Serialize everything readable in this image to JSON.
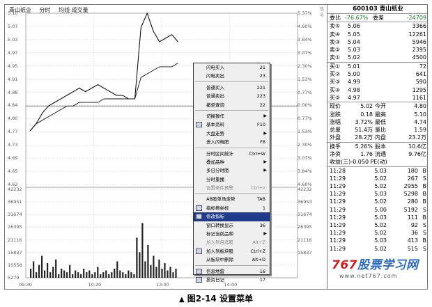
{
  "chart": {
    "title_stock": "青山纸业",
    "title_mode": "分时",
    "title_legend": "均线 成交量",
    "price_labels_left": [
      "5.10",
      "5.07",
      "5.03",
      "4.97",
      "4.95",
      "4.91",
      "4.88",
      "4.84",
      "4.80",
      "4.77",
      "4.73",
      "4.69",
      "4.65",
      "4.62"
    ],
    "pct_labels_right": [
      "5.37%",
      "4.60%",
      "3.84%",
      "3.07%",
      "2.30%",
      "1.53%",
      "0.77%",
      "0.00%",
      "0.77%",
      "1.53%",
      "2.30%",
      "3.07%",
      "3.84%",
      "4.60%"
    ],
    "vol_labels_left": [
      "42232",
      "36951",
      "31674",
      "26395",
      "21116",
      "15837",
      "10558",
      "5279"
    ],
    "vol_labels_right": [
      "42232",
      "36953",
      "31674",
      "26395",
      "21116",
      "15837"
    ],
    "time_labels": [
      "09:30",
      "10:30",
      "13:00",
      "14:00"
    ],
    "signal": "信号"
  },
  "chart_data": {
    "type": "line",
    "series": [
      {
        "name": "分时",
        "values": [
          4.77,
          4.79,
          4.82,
          4.84,
          4.85,
          4.86,
          4.87,
          4.88,
          4.89,
          4.88,
          4.89,
          4.9,
          4.89,
          4.88,
          4.87,
          4.87,
          4.86,
          4.86,
          5.06,
          5.1,
          5.05,
          5.02,
          5.03,
          5.04,
          5.02
        ]
      },
      {
        "name": "均线",
        "values": [
          4.77,
          4.79,
          4.8,
          4.81,
          4.82,
          4.83,
          4.84,
          4.84,
          4.85,
          4.85,
          4.85,
          4.85,
          4.86,
          4.86,
          4.86,
          4.86,
          4.86,
          4.86,
          4.92,
          4.93,
          4.94,
          4.95,
          4.95,
          4.95,
          4.96
        ]
      }
    ],
    "prev_close": 4.84,
    "ylim": [
      4.62,
      5.1
    ],
    "volume_ylim": [
      0,
      42232
    ]
  },
  "menu": {
    "items": [
      {
        "label": "闪电买入",
        "shortcut": "21",
        "state": "normal",
        "arrow": false,
        "icon": false
      },
      {
        "label": "闪电卖出",
        "shortcut": "23",
        "state": "normal",
        "arrow": false,
        "icon": false
      },
      {
        "sep": true
      },
      {
        "label": "普通买入",
        "shortcut": "221",
        "state": "normal",
        "arrow": false,
        "icon": false
      },
      {
        "label": "普通卖出",
        "shortcut": "223",
        "state": "normal",
        "arrow": false,
        "icon": false
      },
      {
        "label": "撤单查询",
        "shortcut": "22",
        "state": "normal",
        "arrow": false,
        "icon": false
      },
      {
        "sep": true
      },
      {
        "label": "切换操作",
        "shortcut": "",
        "state": "normal",
        "arrow": true,
        "icon": false
      },
      {
        "label": "基本资料",
        "shortcut": "F10",
        "state": "normal",
        "arrow": false,
        "icon": true
      },
      {
        "label": "大盘走势",
        "shortcut": "",
        "state": "normal",
        "arrow": true,
        "icon": false
      },
      {
        "label": "进入闪电图",
        "shortcut": "F8",
        "state": "normal",
        "arrow": false,
        "icon": false
      },
      {
        "sep": true
      },
      {
        "label": "分时区间统计",
        "shortcut": "Ctrl+W",
        "state": "normal",
        "arrow": false,
        "icon": false
      },
      {
        "label": "叠加品种",
        "shortcut": "",
        "state": "normal",
        "arrow": true,
        "icon": false
      },
      {
        "label": "多日分时图",
        "shortcut": "",
        "state": "normal",
        "arrow": true,
        "icon": false
      },
      {
        "label": "分时重播",
        "shortcut": "",
        "state": "normal",
        "arrow": false,
        "icon": false
      },
      {
        "label": "设置条件预警",
        "shortcut": "Ctrl+Y",
        "state": "disabled",
        "arrow": false,
        "icon": false
      },
      {
        "sep": true
      },
      {
        "label": "AB股单场走势",
        "shortcut": "TAB",
        "state": "normal",
        "arrow": false,
        "icon": false
      },
      {
        "label": "指标擦坐标",
        "shortcut": "1",
        "state": "normal",
        "arrow": false,
        "icon": true
      },
      {
        "label": "修改指标",
        "shortcut": "",
        "state": "highlight",
        "arrow": false,
        "icon": true
      },
      {
        "label": "窗口转换显示",
        "shortcut": "36",
        "state": "normal",
        "arrow": false,
        "icon": false
      },
      {
        "label": "标记当前品种",
        "shortcut": "",
        "state": "normal",
        "arrow": true,
        "icon": false
      },
      {
        "label": "加入到自选股",
        "shortcut": "Alt+Z",
        "state": "disabled",
        "arrow": false,
        "icon": false
      },
      {
        "label": "加入到板块股",
        "shortcut": "Ctrl+Z",
        "state": "normal",
        "arrow": false,
        "icon": true
      },
      {
        "label": "从板块中删除",
        "shortcut": "Alt+D",
        "state": "normal",
        "arrow": false,
        "icon": false
      },
      {
        "sep": true
      },
      {
        "label": "信息地雷",
        "shortcut": "16",
        "state": "normal",
        "arrow": false,
        "icon": true
      },
      {
        "label": "投资日记",
        "shortcut": "17",
        "state": "normal",
        "arrow": false,
        "icon": true
      }
    ]
  },
  "quote": {
    "header": "600103 青山纸业",
    "ratio_label": "委比",
    "ratio_value": "-76.67%",
    "diff_label": "委差",
    "diff_value": "-24709",
    "asks": [
      {
        "label": "卖⑤",
        "price": "5.06",
        "vol": "3366"
      },
      {
        "label": "卖④",
        "price": "5.05",
        "vol": "12261"
      },
      {
        "label": "卖③",
        "price": "5.04",
        "vol": "5946"
      },
      {
        "label": "卖②",
        "price": "5.03",
        "vol": "2395"
      },
      {
        "label": "卖①",
        "price": "5.02",
        "vol": "4500"
      }
    ],
    "bids": [
      {
        "label": "买①",
        "price": "5.01",
        "vol": "72"
      },
      {
        "label": "买②",
        "price": "5.00",
        "vol": "641"
      },
      {
        "label": "买③",
        "price": "4.99",
        "vol": "590"
      },
      {
        "label": "买④",
        "price": "4.98",
        "vol": "1295"
      },
      {
        "label": "买⑤",
        "price": "4.97",
        "vol": "1161"
      }
    ],
    "stats": [
      {
        "k1": "现价",
        "v1": "5.02",
        "k2": "今开",
        "v2": "4.80"
      },
      {
        "k1": "涨跌",
        "v1": "0.18",
        "k2": "最高",
        "v2": "5.10"
      },
      {
        "k1": "涨幅",
        "v1": "3.72%",
        "k2": "最低",
        "v2": "4.74"
      },
      {
        "k1": "总量",
        "v1": "51.4万",
        "k2": "量比",
        "v2": "1.59"
      },
      {
        "k1": "外盘",
        "v1": "28.2万",
        "k2": "内盘",
        "v2": "23.2万"
      }
    ],
    "stats2": [
      {
        "k1": "换手",
        "v1": "5.26%",
        "k2": "股本",
        "v2": "10.6亿"
      },
      {
        "k1": "净资",
        "v1": "1.76",
        "k2": "流通",
        "v2": "9.76亿"
      }
    ],
    "earnings": "收益(三)-0.050 PE(动)",
    "ticks": [
      {
        "time": "11:28",
        "price": "5.03",
        "vol": "180",
        "bs": "B"
      },
      {
        "time": "11:29",
        "price": "5.02",
        "vol": "267",
        "bs": "S"
      },
      {
        "time": "11:29",
        "price": "5.02",
        "vol": "2955",
        "bs": "B"
      },
      {
        "time": "11:29",
        "price": "5.03",
        "vol": "5298",
        "bs": "B"
      },
      {
        "time": "11:29",
        "price": "5.02",
        "vol": "280",
        "bs": "B"
      },
      {
        "time": "11:29",
        "price": "5.00",
        "vol": "5192",
        "bs": "S"
      },
      {
        "time": "11:29",
        "price": "5.03",
        "vol": "111",
        "bs": "B"
      },
      {
        "time": "11:29",
        "price": "5.02",
        "vol": "92",
        "bs": "S"
      },
      {
        "time": "11:29",
        "price": "5.02",
        "vol": "36",
        "bs": "S"
      },
      {
        "time": "11:29",
        "price": "5.03",
        "vol": "413",
        "bs": "B"
      },
      {
        "time": "11:29",
        "price": "5.02",
        "vol": "515",
        "bs": "S"
      }
    ]
  },
  "watermark": {
    "logo_num": "767",
    "logo_text": "股票学习网",
    "url": "www.net767.com"
  },
  "caption": {
    "marker": "▲",
    "text": "图2-14 设置菜单"
  }
}
